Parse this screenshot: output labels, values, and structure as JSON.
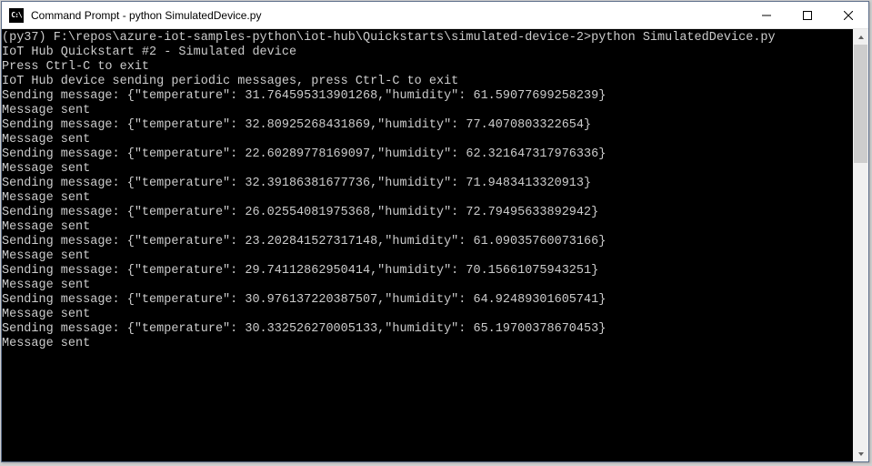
{
  "window": {
    "title": "Command Prompt - python  SimulatedDevice.py",
    "icon_label": "C:\\"
  },
  "terminal": {
    "lines": [
      "",
      "(py37) F:\\repos\\azure-iot-samples-python\\iot-hub\\Quickstarts\\simulated-device-2>python SimulatedDevice.py",
      "IoT Hub Quickstart #2 - Simulated device",
      "Press Ctrl-C to exit",
      "IoT Hub device sending periodic messages, press Ctrl-C to exit",
      "Sending message: {\"temperature\": 31.764595313901268,\"humidity\": 61.59077699258239}",
      "Message sent",
      "Sending message: {\"temperature\": 32.80925268431869,\"humidity\": 77.4070803322654}",
      "Message sent",
      "Sending message: {\"temperature\": 22.60289778169097,\"humidity\": 62.321647317976336}",
      "Message sent",
      "Sending message: {\"temperature\": 32.39186381677736,\"humidity\": 71.9483413320913}",
      "Message sent",
      "Sending message: {\"temperature\": 26.02554081975368,\"humidity\": 72.79495633892942}",
      "Message sent",
      "Sending message: {\"temperature\": 23.202841527317148,\"humidity\": 61.09035760073166}",
      "Message sent",
      "Sending message: {\"temperature\": 29.74112862950414,\"humidity\": 70.15661075943251}",
      "Message sent",
      "Sending message: {\"temperature\": 30.976137220387507,\"humidity\": 64.92489301605741}",
      "Message sent",
      "Sending message: {\"temperature\": 30.332526270005133,\"humidity\": 65.19700378670453}",
      "Message sent"
    ]
  }
}
